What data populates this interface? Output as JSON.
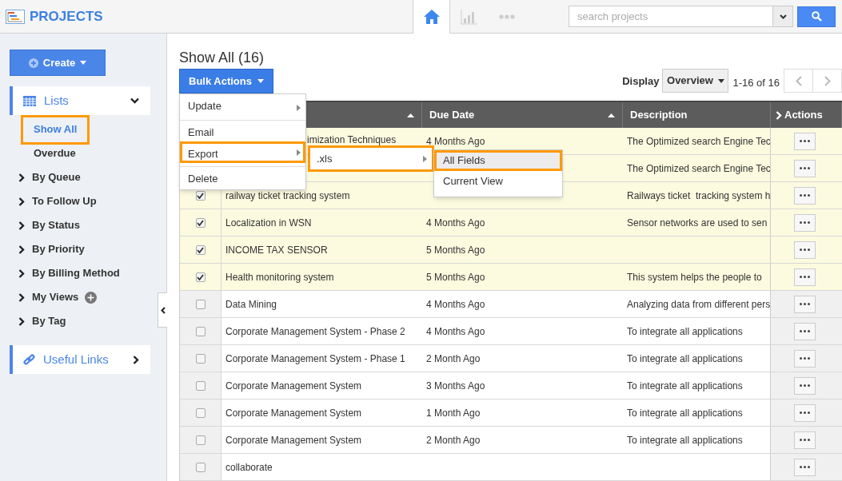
{
  "app": {
    "title": "PROJECTS"
  },
  "topbar": {
    "nav": [
      {
        "kind": "home",
        "selected": true
      },
      {
        "kind": "chart",
        "selected": false
      },
      {
        "kind": "more",
        "selected": false
      }
    ],
    "search": {
      "placeholder": "search projects"
    }
  },
  "sidebar": {
    "create": "Create",
    "sections": [
      {
        "kind": "lists",
        "label": "Lists",
        "expanded": true,
        "items": [
          {
            "kind": "plain",
            "label": "Show All",
            "selected": true,
            "highlighted": true
          },
          {
            "kind": "plain",
            "label": "Overdue",
            "selected": false,
            "highlighted": false
          },
          {
            "kind": "group",
            "label": "By Queue",
            "selected": false,
            "highlighted": false
          },
          {
            "kind": "group",
            "label": "To Follow Up",
            "selected": false,
            "highlighted": false
          },
          {
            "kind": "group",
            "label": "By Status",
            "selected": false,
            "highlighted": false
          },
          {
            "kind": "group",
            "label": "By Priority",
            "selected": false,
            "highlighted": false
          },
          {
            "kind": "group",
            "label": "By Billing Method",
            "selected": false,
            "highlighted": false
          },
          {
            "kind": "group",
            "label": "My Views",
            "selected": false,
            "highlighted": false,
            "addable": true
          },
          {
            "kind": "group",
            "label": "By Tag",
            "selected": false,
            "highlighted": false
          }
        ]
      },
      {
        "kind": "links",
        "label": "Useful Links",
        "expanded": false
      }
    ]
  },
  "main": {
    "heading": "Show All (16)",
    "bulk_button": "Bulk Actions",
    "display_label": "Display",
    "display_value": "Overview",
    "range": "1-16 of 16",
    "menu": [
      {
        "label": "Update",
        "submenu": true,
        "highlighted": false,
        "divider_before": false
      },
      {
        "label": "Email",
        "submenu": false,
        "highlighted": false,
        "divider_before": true
      },
      {
        "label": "Export",
        "submenu": true,
        "highlighted": true,
        "divider_before": false
      },
      {
        "label": "Delete",
        "submenu": false,
        "highlighted": false,
        "divider_before": true
      }
    ],
    "export_menu": [
      {
        "label": ".xls",
        "submenu": true,
        "highlighted": true
      }
    ],
    "format_menu": [
      {
        "label": "All Fields",
        "highlighted": true
      },
      {
        "label": "Current View",
        "highlighted": false
      }
    ],
    "table": {
      "columns": [
        {
          "sortable": true
        },
        {
          "label": "Due Date",
          "sortable": true
        },
        {
          "label": "Description",
          "sortable": false
        },
        {
          "label": "Actions",
          "expandable": true
        }
      ],
      "rows": [
        {
          "selected": true,
          "name": "imization Techniques",
          "due": "4 Months Ago",
          "description": "The Optimized search Engine Tec"
        },
        {
          "selected": true,
          "description": "The Optimized search Engine Tec"
        },
        {
          "selected": true,
          "checked": true,
          "name": "railway ticket tracking system",
          "description": "Railways ticket  tracking system h"
        },
        {
          "selected": true,
          "checked": true,
          "name": "Localization in WSN",
          "due": "4 Months Ago",
          "description": "Sensor networks are used to sen"
        },
        {
          "selected": true,
          "checked": true,
          "name": "INCOME TAX SENSOR",
          "due": "5 Months Ago"
        },
        {
          "selected": true,
          "checked": true,
          "name": "Health monitoring system",
          "due": "5 Months Ago",
          "description": "This system helps the people to"
        },
        {
          "selected": false,
          "checked": false,
          "name": "Data Mining",
          "due": "4 Months Ago",
          "description": "Analyzing data from different pers"
        },
        {
          "selected": false,
          "checked": false,
          "name": "Corporate Management System - Phase 2",
          "due": "4 Months Ago",
          "description": "To integrate all applications"
        },
        {
          "selected": false,
          "checked": false,
          "name": "Corporate Management System - Phase 1",
          "due": "2 Month Ago",
          "description": "To integrate all applications"
        },
        {
          "selected": false,
          "checked": false,
          "name": "Corporate Management System",
          "due": "3 Months Ago",
          "description": "To integrate all applications"
        },
        {
          "selected": false,
          "checked": false,
          "name": "Corporate Management System",
          "due": "1 Month Ago",
          "description": "To integrate all applications"
        },
        {
          "selected": false,
          "checked": false,
          "name": "Corporate Management System",
          "due": "2 Month Ago",
          "description": "To integrate all applications"
        },
        {
          "selected": false,
          "checked": false,
          "name": "collaborate"
        }
      ]
    }
  }
}
